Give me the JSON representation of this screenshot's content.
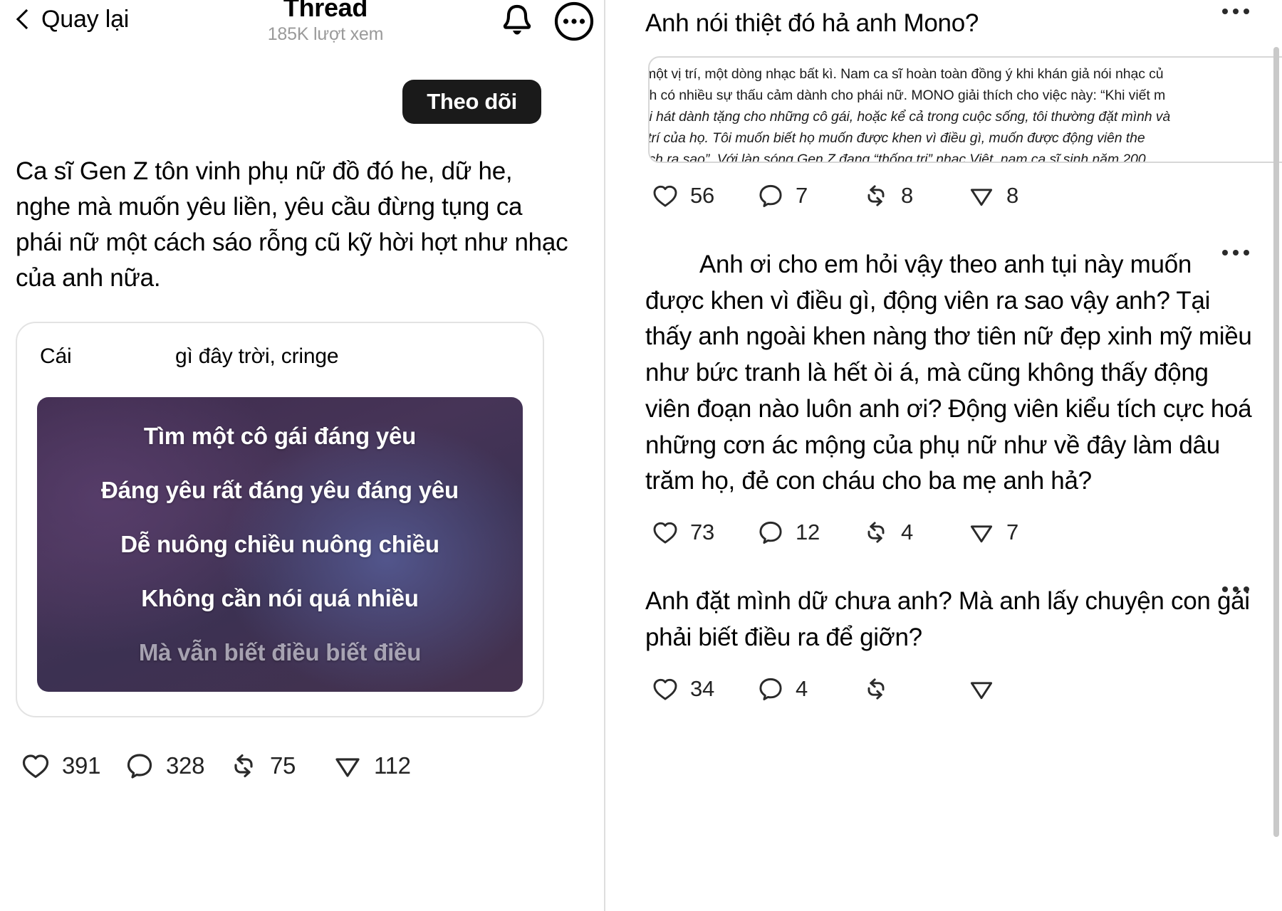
{
  "header": {
    "back_label": "Quay lại",
    "title": "Thread",
    "views": "185K lượt xem",
    "bell_icon": "bell-icon",
    "more_icon": "more-circle-icon"
  },
  "main_post": {
    "follow_label": "Theo dõi",
    "body": "Ca sĩ Gen Z tôn vinh phụ nữ đồ đó he, dữ he, nghe mà muốn yêu liền, yêu cầu đừng tụng ca phái nữ một cách sáo rỗng cũ kỹ hời hợt như nhạc của anh nữa.",
    "quote": {
      "head_left": "Cái",
      "head_right": "gì đây trời, cringe",
      "lyrics": [
        "Tìm một cô gái đáng yêu",
        "Đáng yêu rất đáng yêu đáng yêu",
        "Dễ nuông chiều nuông chiều",
        "Không cần nói quá nhiều",
        "Mà vẫn biết điều biết điều"
      ],
      "lyrics_dim_index": 4
    },
    "actions": {
      "like": "391",
      "comment": "328",
      "repost": "75",
      "share": "112"
    }
  },
  "replies": [
    {
      "text": "Anh nói thiệt đó hả anh Mono?",
      "has_article": true,
      "article_lines": [
        {
          "text": "y một vị trí, một dòng nhạc bất kì. Nam ca sĩ hoàn toàn đồng ý khi khán giả nói nhạc củ",
          "italic": false
        },
        {
          "text": "anh có nhiều sự thấu cảm dành cho phái nữ. MONO giải thích cho việc này: “Khi viết m",
          "italic": false
        },
        {
          "text": "bài hát dành tặng cho những cô gái, hoặc kể cả trong cuộc sống, tôi thường đặt mình và",
          "italic": true
        },
        {
          "text": "vị trí của họ. Tôi muốn biết họ muốn được khen vì điều gì, muốn được động viên the",
          "italic": true
        },
        {
          "text": "cách ra sao”.  Với làn sóng Gen Z đang “thống trị” nhạc Việt, nam ca sĩ sinh năm 200",
          "italic": true
        }
      ],
      "actions": {
        "like": "56",
        "comment": "7",
        "repost": "8",
        "share": "8"
      }
    },
    {
      "text": "Anh ơi cho em hỏi vậy theo anh tụi này muốn được khen vì điều gì, động viên ra sao vậy anh? Tại thấy anh ngoài khen nàng thơ tiên nữ đẹp xinh mỹ miều như bức tranh là hết òi á, mà cũng không thấy động viên đoạn nào luôn anh ơi? Động viên kiểu tích cực hoá những cơn ác mộng của phụ nữ như về đây làm dâu trăm họ, đẻ con cháu cho ba mẹ anh hả?",
      "indented": true,
      "has_article": false,
      "actions": {
        "like": "73",
        "comment": "12",
        "repost": "4",
        "share": "7"
      }
    },
    {
      "text": "Anh đặt mình dữ chưa anh? Mà anh lấy chuyện con gái phải biết điều ra để giỡn?",
      "has_article": false,
      "actions": {
        "like": "34",
        "comment": "4",
        "repost": "",
        "share": ""
      }
    }
  ],
  "icons": {
    "heart": "heart-icon",
    "comment": "comment-icon",
    "repost": "repost-icon",
    "share": "share-icon",
    "dots": "more-dots-icon"
  },
  "colors": {
    "accent_dark": "#1a1a1a",
    "muted_text": "#9a9a9a",
    "border": "#e3e3e3"
  }
}
